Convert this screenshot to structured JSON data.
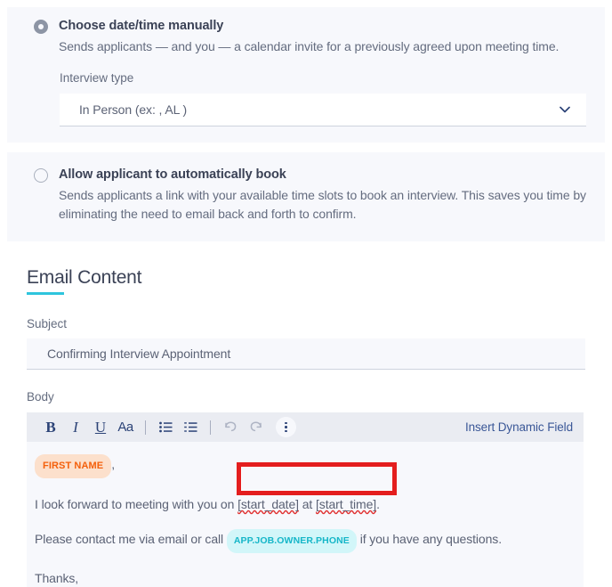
{
  "scheduling": {
    "options": [
      {
        "id": "manual",
        "title": "Choose date/time manually",
        "description": "Sends applicants — and you — a calendar invite for a previously agreed upon meeting time.",
        "selected": true,
        "radio_icon": "radio-selected-icon"
      },
      {
        "id": "auto-book",
        "title": "Allow applicant to automatically book",
        "description": "Sends applicants a link with your available time slots to book an interview. This saves you time by eliminating the need to email back and forth to confirm.",
        "selected": false,
        "radio_icon": "radio-unselected-icon"
      }
    ],
    "interview_type": {
      "label": "Interview type",
      "value": "In Person (ex: , AL )",
      "chevron_icon": "chevron-down-icon"
    }
  },
  "email_content": {
    "heading": "Email Content",
    "accent_color": "#2ec5dd",
    "subject": {
      "label": "Subject",
      "value": "Confirming Interview Appointment"
    },
    "body": {
      "label": "Body",
      "toolbar": {
        "bold_label": "B",
        "italic_label": "I",
        "underline_label": "U",
        "font_label": "Aa",
        "bullet_list_icon": "bulleted-list-icon",
        "numbered_list_icon": "numbered-list-icon",
        "undo_icon": "undo-icon",
        "redo_icon": "redo-icon",
        "more_icon": "more-vertical-icon",
        "insert_dynamic_field_label": "Insert Dynamic Field"
      },
      "content": {
        "greeting_tag": "FIRST NAME",
        "greeting_comma": ",",
        "line_meeting_prefix": "I look forward to meeting with you on ",
        "line_meeting_date_token": "[start_date]",
        "line_meeting_middle": " at ",
        "line_meeting_time_token": "[start_time]",
        "line_meeting_suffix": ".",
        "line_contact_prefix": "Please contact me via email or call ",
        "line_contact_tag": "APP.JOB.OWNER.PHONE",
        "line_contact_suffix": " if you have any questions.",
        "line_thanks": "Thanks,"
      }
    }
  },
  "annotation": {
    "type": "highlight-box",
    "color": "#e41e1e",
    "targets": "[start_date] at [start_time]."
  }
}
